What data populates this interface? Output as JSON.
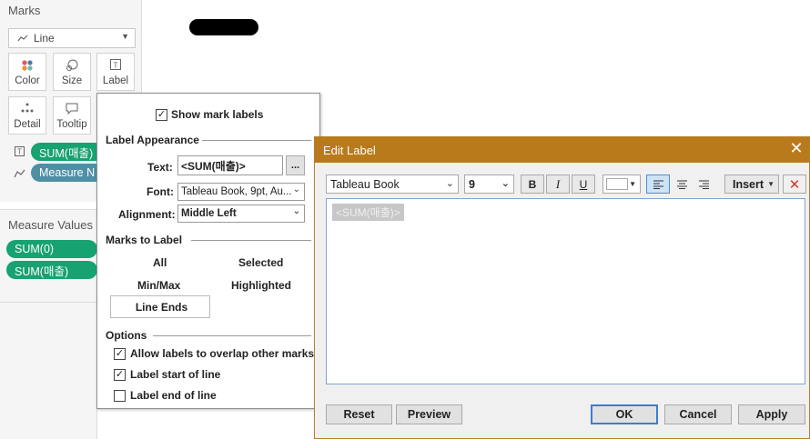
{
  "marks": {
    "title": "Marks",
    "mark_type": "Line",
    "cards": {
      "color": "Color",
      "size": "Size",
      "label": "Label",
      "detail": "Detail",
      "tooltip": "Tooltip"
    },
    "pills": [
      {
        "label": "SUM(매출)"
      },
      {
        "label": "Measure N"
      }
    ]
  },
  "measure_values": {
    "title": "Measure Values",
    "pills": [
      "SUM(0)",
      "SUM(매출)"
    ]
  },
  "label_popup": {
    "show_mark_labels": "Show mark labels",
    "label_appearance": "Label Appearance",
    "text_label": "Text:",
    "text_value": "<SUM(매출)>",
    "text_button": "...",
    "font_label": "Font:",
    "font_value": "Tableau Book, 9pt, Au...",
    "alignment_label": "Alignment:",
    "alignment_value": "Middle Left",
    "marks_to_label": "Marks to Label",
    "opt_all": "All",
    "opt_selected": "Selected",
    "opt_minmax": "Min/Max",
    "opt_highlighted": "Highlighted",
    "opt_line_ends": "Line Ends",
    "options": "Options",
    "allow_overlap": "Allow labels to overlap other marks",
    "label_start": "Label start of line",
    "label_end": "Label end of line"
  },
  "edit_label": {
    "title": "Edit Label",
    "font": "Tableau Book",
    "size": "9",
    "bold": "B",
    "italic": "I",
    "underline": "U",
    "insert": "Insert",
    "content": "<SUM(매출)>",
    "reset": "Reset",
    "preview": "Preview",
    "ok": "OK",
    "cancel": "Cancel",
    "apply": "Apply"
  },
  "colors": {
    "green_pill": "#17a271",
    "blue_pill": "#4f8fa6",
    "dialog_title": "#b97a1b"
  }
}
